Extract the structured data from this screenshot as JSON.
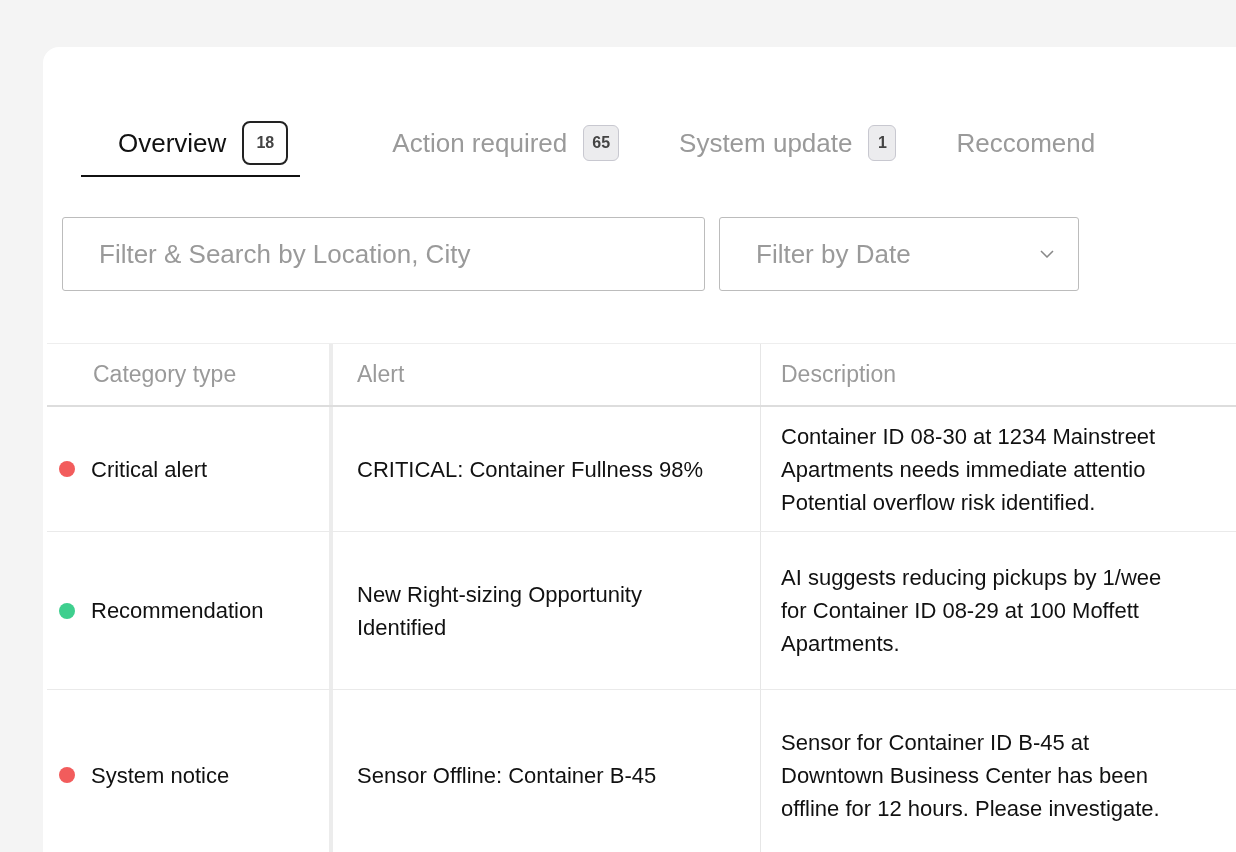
{
  "tabs": [
    {
      "label": "Overview",
      "count": "18",
      "selected": true
    },
    {
      "label": "Action required",
      "count": "65",
      "selected": false
    },
    {
      "label": "System update",
      "count": "1",
      "selected": false
    },
    {
      "label": "Reccomend",
      "selected": false
    }
  ],
  "filters": {
    "search": {
      "placeholder": "Filter & Search by Location, City"
    },
    "date": {
      "placeholder": "Filter by Date"
    }
  },
  "table": {
    "columns": [
      "Category type",
      "Alert",
      "Description"
    ],
    "rows": [
      {
        "category": "Critical alert",
        "color": "#f25c5c",
        "alert": [
          "CRITICAL: Container Fullness 98%"
        ],
        "description": [
          "Container ID 08-30 at 1234 Mainstreet",
          "Apartments needs immediate attentio",
          "Potential overflow risk identified."
        ]
      },
      {
        "category": "Recommendation",
        "color": "#3ecf8e",
        "alert": [
          "New Right-sizing Opportunity",
          "Identified"
        ],
        "description": [
          "AI suggests reducing pickups by 1/wee",
          "for Container ID 08-29 at 100 Moffett",
          "Apartments."
        ]
      },
      {
        "category": "System notice",
        "color": "#f25c5c",
        "alert": [
          "Sensor Offline: Container B-45"
        ],
        "description": [
          "Sensor for Container ID B-45 at",
          "Downtown Business Center has been",
          "offline for 12 hours. Please investigate."
        ]
      }
    ]
  }
}
